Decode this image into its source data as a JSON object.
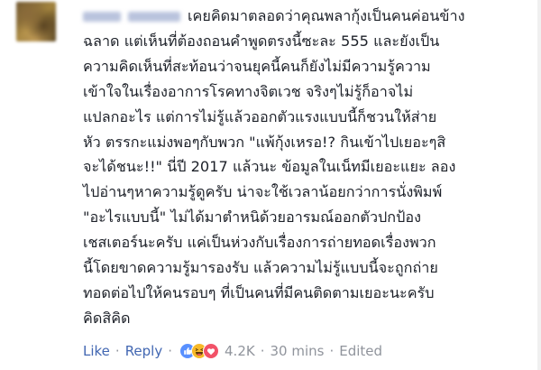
{
  "comment": {
    "author_name": "",
    "lines": [
      "เคยคิดมาตลอดว่าคุณพลากุ้งเป็นคนค่อนข้าง",
      "ฉลาด แต่เห็นที่ต้องถอนคำพูดตรงนี้ซะละ 555 และยังเป็น",
      "ความคิดเห็นที่สะท้อนว่าจนยุคนี้คนก็ยังไม่มีความรู้ความ",
      "เข้าใจในเรื่องอาการโรคทางจิตเวช จริงๆไม่รู้ก็อาจไม่",
      "แปลกอะไร แต่การไม่รู้แล้วออกตัวแรงแบบนี้ก็ชวนให้ส่าย",
      "หัว ตรรกะแม่งพอๆกับพวก \"แพ้กุ้งเหรอ!? กินเข้าไปเยอะๆสิ",
      "จะได้ชนะ!!\" นี่ปี 2017 แล้วนะ ข้อมูลในเน็ทมีเยอะแยะ ลอง",
      "ไปอ่านๆหาความรู้ดูครับ น่าจะใช้เวลาน้อยกว่าการนั่งพิมพ์",
      "\"อะไรแบบนี้\" ไม่ได้มาตำหนิด้วยอารมณ์ออกตัวปกป้อง",
      "เชสเตอร์นะครับ แค่เป็นห่วงกับเรื่องการถ่ายทอดเรื่องพวก",
      "นี้โดยขาดความรู้มารองรับ แล้วความไม่รู้แบบนี้จะถูกถ่าย",
      "ทอดต่อไปให้คนรอบๆ ที่เป็นคนที่มีคนติดตามเยอะนะครับ",
      "คิดสิคิด"
    ]
  },
  "actions": {
    "like_label": "Like",
    "separator": "·",
    "reply_label": "Reply",
    "reaction_icons": [
      "like-reaction-icon",
      "haha-reaction-icon",
      "love-reaction-icon"
    ],
    "reaction_count": "4.2K",
    "timestamp": "30 mins",
    "edited_label": "Edited"
  },
  "colors": {
    "text": "#1d2129",
    "link": "#4267b2",
    "meta": "#90949c",
    "like_blue": "#5890ff",
    "haha_yellow": "#f7b928",
    "love_red": "#f25268"
  }
}
